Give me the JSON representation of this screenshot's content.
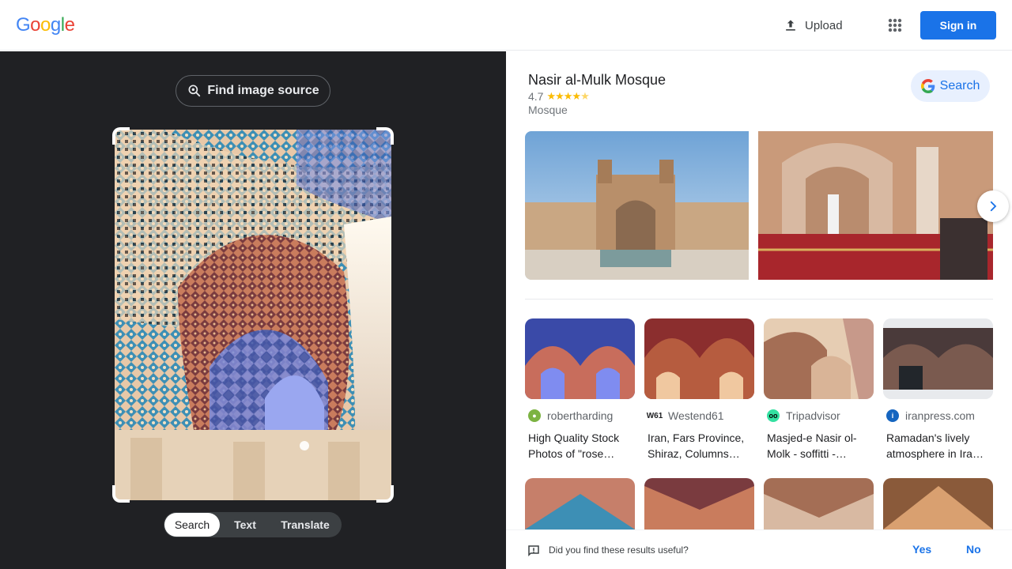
{
  "header": {
    "logo_letters": [
      "G",
      "o",
      "o",
      "g",
      "l",
      "e"
    ],
    "logo_colors": [
      "#4285F4",
      "#EA4335",
      "#FBBC05",
      "#4285F4",
      "#34A853",
      "#EA4335"
    ],
    "upload_label": "Upload",
    "apps_icon": "apps-grid-icon",
    "signin_label": "Sign in"
  },
  "left": {
    "find_source_label": "Find image source",
    "modes": [
      "Search",
      "Text",
      "Translate"
    ],
    "active_mode": "Search"
  },
  "knowledge": {
    "title": "Nasir al-Mulk Mosque",
    "rating": "4.7",
    "rating_stars": 4.7,
    "subtitle": "Mosque",
    "search_button": "Search"
  },
  "results": [
    {
      "source": "robertharding",
      "title_line1": "High Quality Stock",
      "title_line2": "Photos of \"rose…",
      "icon_color": "#7cb342"
    },
    {
      "source": "Westend61",
      "title_line1": "Iran, Fars Province,",
      "title_line2": "Shiraz, Columns…",
      "icon_color": "#202124"
    },
    {
      "source": "Tripadvisor",
      "title_line1": "Masjed-e Nasir ol-",
      "title_line2": "Molk - soffitti -…",
      "icon_color": "#34e0a1"
    },
    {
      "source": "iranpress.com",
      "title_line1": "Ramadan's lively",
      "title_line2": "atmosphere in Ira…",
      "icon_color": "#1565c0"
    }
  ],
  "feedback": {
    "question": "Did you find these results useful?",
    "yes": "Yes",
    "no": "No"
  }
}
